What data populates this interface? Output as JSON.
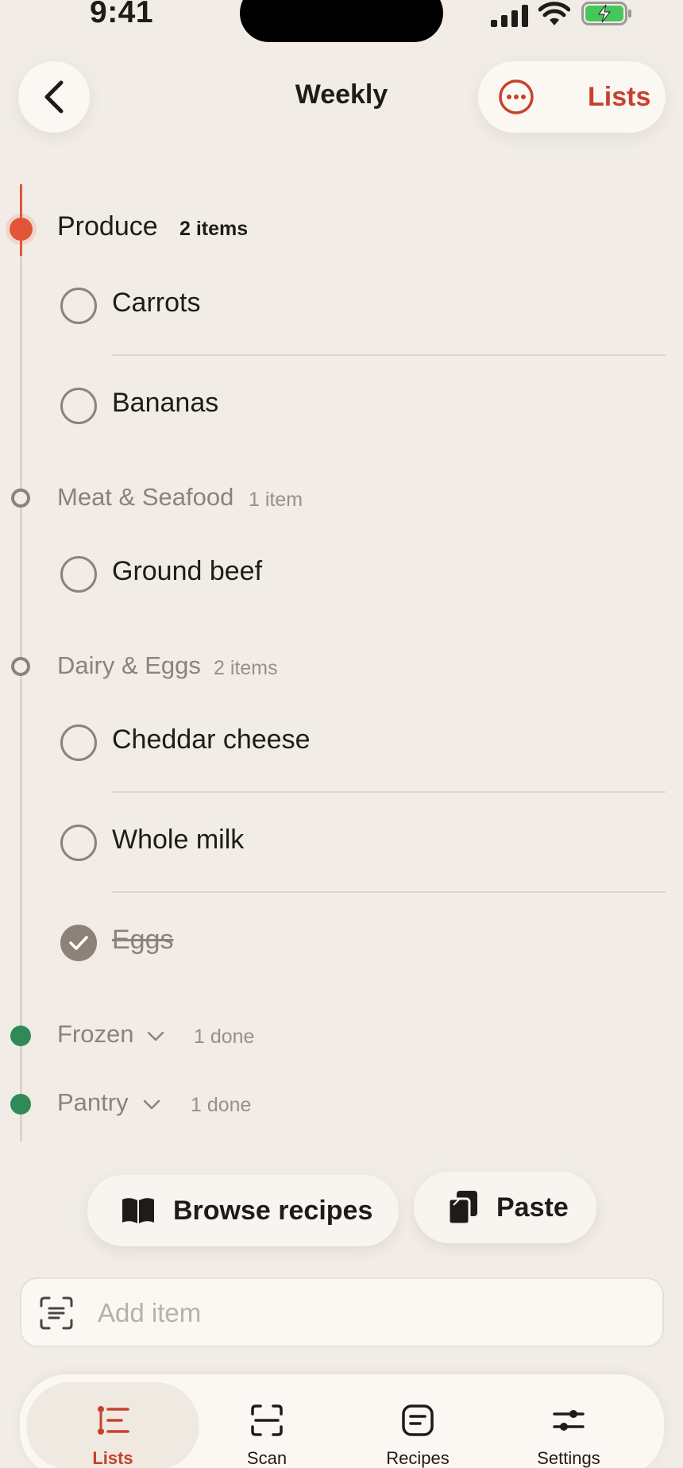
{
  "status_bar": {
    "time": "9:41"
  },
  "header": {
    "title": "Weekly",
    "lists_label": "Lists"
  },
  "sections": [
    {
      "name": "Produce",
      "count": "2 items",
      "state": "active",
      "items": [
        {
          "label": "Carrots",
          "checked": false
        },
        {
          "label": "Bananas",
          "checked": false
        }
      ]
    },
    {
      "name": "Meat & Seafood",
      "count": "1 item",
      "state": "pending",
      "items": [
        {
          "label": "Ground beef",
          "checked": false
        }
      ]
    },
    {
      "name": "Dairy & Eggs",
      "count": "2 items",
      "state": "pending",
      "items": [
        {
          "label": "Cheddar cheese",
          "checked": false
        },
        {
          "label": "Whole milk",
          "checked": false
        },
        {
          "label": "Eggs",
          "checked": true
        }
      ]
    },
    {
      "name": "Frozen",
      "count": "1 done",
      "state": "done",
      "collapsed": true
    },
    {
      "name": "Pantry",
      "count": "1 done",
      "state": "done",
      "collapsed": true
    }
  ],
  "actions": {
    "browse_label": "Browse recipes",
    "paste_label": "Paste"
  },
  "add_item": {
    "placeholder": "Add item"
  },
  "tabs": [
    {
      "label": "Lists",
      "icon": "lists-icon",
      "active": true
    },
    {
      "label": "Scan",
      "icon": "scan-icon",
      "active": false
    },
    {
      "label": "Recipes",
      "icon": "recipes-icon",
      "active": false
    },
    {
      "label": "Settings",
      "icon": "settings-icon",
      "active": false
    }
  ],
  "colors": {
    "accent": "#c8412b",
    "active_dot": "#e2553a",
    "done_dot": "#2f8a57",
    "background": "#f1ece6"
  }
}
